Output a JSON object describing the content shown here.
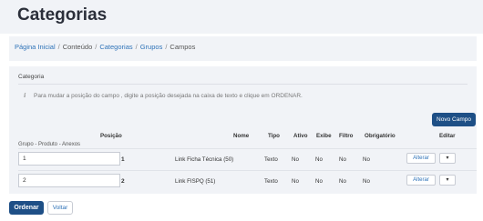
{
  "page": {
    "title": "Categorias"
  },
  "breadcrumb": {
    "items": [
      "Página Inicial",
      "Conteúdo",
      "Categorias",
      "Grupos",
      "Campos"
    ],
    "separator": "/"
  },
  "panel": {
    "title": "Categoria",
    "hint": "Para mudar a posição do campo , digite a posição desejada na caixa de texto e clique em ORDENAR.",
    "new_button": "Novo Campo"
  },
  "table": {
    "headers": [
      "Posição",
      "Nome",
      "Tipo",
      "Ativo",
      "Exibe",
      "Filtro",
      "Obrigatório",
      "Editar"
    ],
    "group_label": "Grupo - Produto - Anexos",
    "rows": [
      {
        "position_value": "1",
        "position_num": "1",
        "name": "Link Ficha Técnica (50)",
        "type": "Texto",
        "active": "No",
        "display": "No",
        "filter": "No",
        "required": "No",
        "edit_label": "Alterar",
        "caret": "▾"
      },
      {
        "position_value": "2",
        "position_num": "2",
        "name": "Link FISPQ (51)",
        "type": "Texto",
        "active": "No",
        "display": "No",
        "filter": "No",
        "required": "No",
        "edit_label": "Alterar",
        "caret": "▾"
      }
    ]
  },
  "footer": {
    "order_button": "Ordenar",
    "back_button": "Voltar"
  },
  "colors": {
    "primary": "#1e4f86",
    "link": "#2f73b8",
    "panel_bg": "#f1f3f7"
  }
}
